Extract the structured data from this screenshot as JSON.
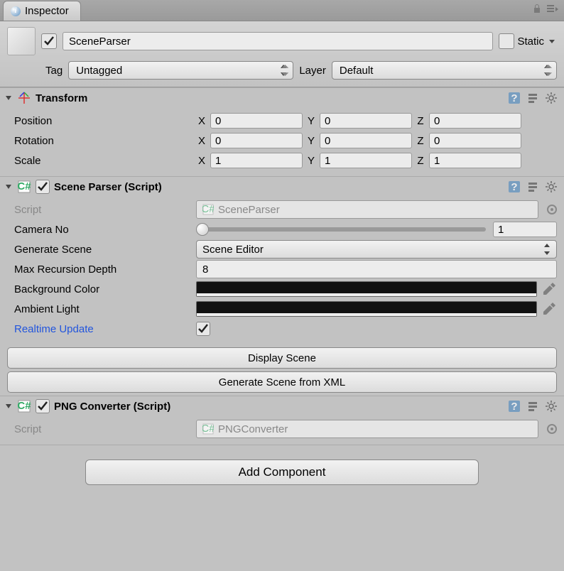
{
  "tab": {
    "title": "Inspector"
  },
  "header": {
    "name": "SceneParser",
    "static_label": "Static",
    "tag_label": "Tag",
    "tag_value": "Untagged",
    "layer_label": "Layer",
    "layer_value": "Default"
  },
  "transform": {
    "title": "Transform",
    "position_label": "Position",
    "rotation_label": "Rotation",
    "scale_label": "Scale",
    "x": "X",
    "y": "Y",
    "z": "Z",
    "pos": {
      "x": "0",
      "y": "0",
      "z": "0"
    },
    "rot": {
      "x": "0",
      "y": "0",
      "z": "0"
    },
    "scl": {
      "x": "1",
      "y": "1",
      "z": "1"
    }
  },
  "sceneParser": {
    "title": "Scene Parser (Script)",
    "script_label": "Script",
    "script_value": "SceneParser",
    "camera_no_label": "Camera No",
    "camera_no_value": "1",
    "generate_scene_label": "Generate Scene",
    "generate_scene_value": "Scene Editor",
    "max_recursion_label": "Max Recursion Depth",
    "max_recursion_value": "8",
    "background_color_label": "Background Color",
    "ambient_light_label": "Ambient Light",
    "realtime_update_label": "Realtime Update",
    "display_scene_btn": "Display Scene",
    "generate_xml_btn": "Generate Scene from XML"
  },
  "pngConverter": {
    "title": "PNG Converter (Script)",
    "script_label": "Script",
    "script_value": "PNGConverter"
  },
  "footer": {
    "add_component": "Add Component"
  }
}
